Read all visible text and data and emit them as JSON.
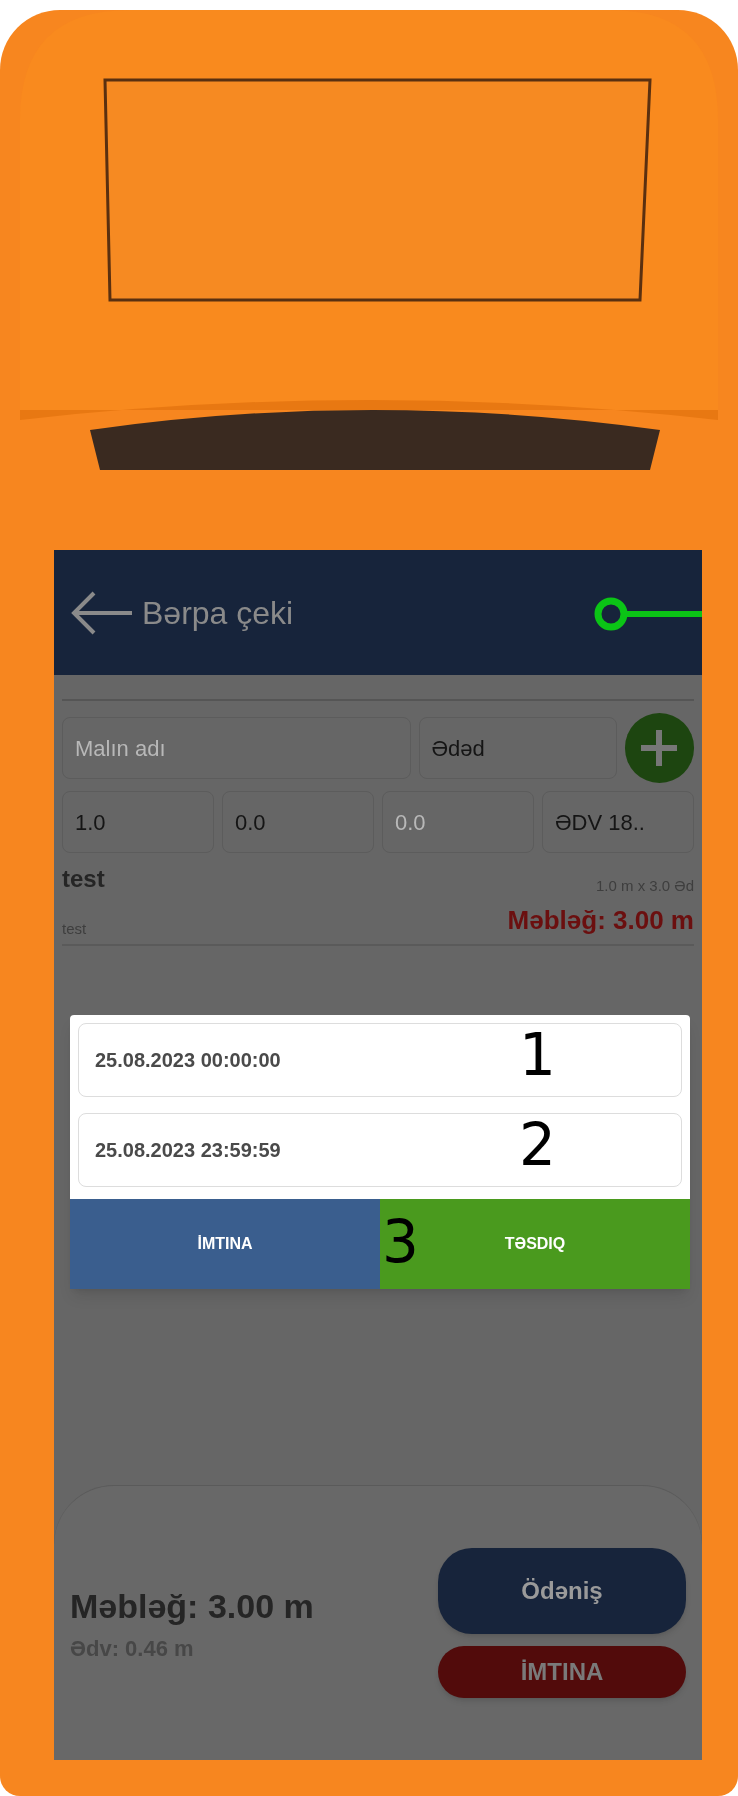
{
  "header": {
    "title": "Bərpa çeki",
    "callout": true
  },
  "form": {
    "name_field": {
      "placeholder": "Malın adı"
    },
    "unit_field": {
      "value": "Ədəd"
    },
    "fields": [
      {
        "value": "1.0"
      },
      {
        "value": "0.0"
      },
      {
        "placeholder": "0.0"
      },
      {
        "value": "ƏDV 18.."
      }
    ]
  },
  "item": {
    "name": "test",
    "quantity": "1.0 m x 3.0 Əd",
    "description": "test",
    "amount": "Məbləğ: 3.00 m"
  },
  "dialog": {
    "fields": [
      {
        "value": "25.08.2023 00:00:00",
        "annotation": "1"
      },
      {
        "value": "25.08.2023 23:59:59",
        "annotation": "2"
      }
    ],
    "buttons": [
      {
        "label": "İMTINA",
        "kind": "cancel"
      },
      {
        "label": "TƏSDIQ",
        "kind": "confirm"
      }
    ],
    "annotation": "3"
  },
  "footer": {
    "total": "Məbləğ: 3.00 m",
    "vat": "Ədv: 0.46 m",
    "buttons": [
      {
        "label": "Ödəniş",
        "kind": "primary"
      },
      {
        "label": "İMTINA",
        "kind": "danger"
      }
    ]
  }
}
